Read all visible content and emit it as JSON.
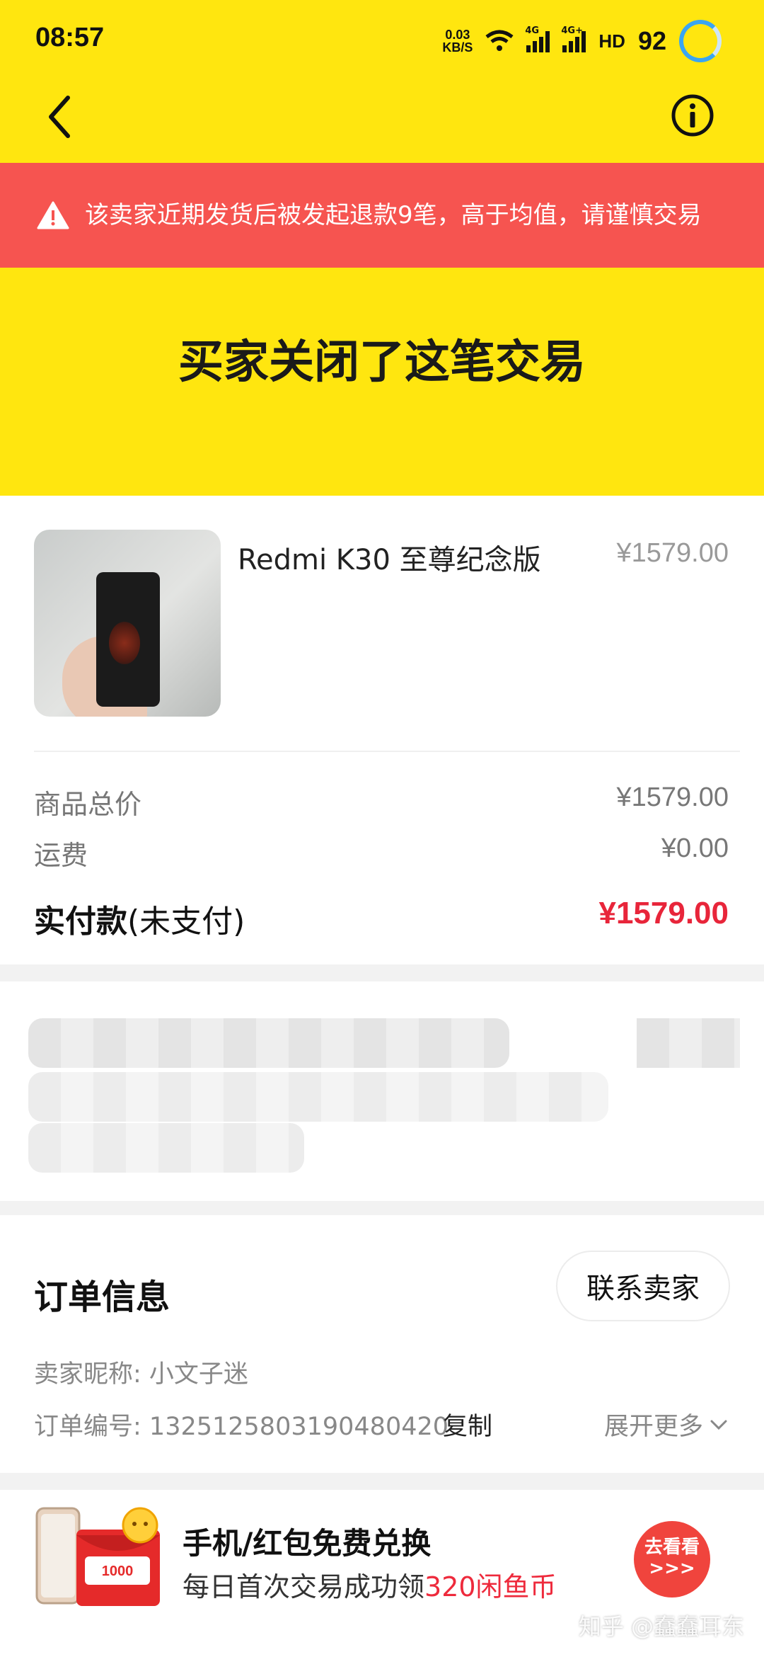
{
  "status_bar": {
    "time": "08:57",
    "net_speed_value": "0.03",
    "net_speed_unit": "KB/S",
    "signal1_label": "4G",
    "signal2_label": "4G+",
    "hd_label": "HD",
    "battery": "92",
    "battery_color": "#3aa5f2"
  },
  "nav": {
    "back_icon": "chevron-left-icon",
    "info_icon": "info-icon"
  },
  "warning": {
    "text": "该卖家近期发货后被发起退款9笔，高于均值，请谨慎交易",
    "bg_color": "#f65450"
  },
  "order_status": {
    "title": "买家关闭了这笔交易",
    "bg_color": "#ffe60f"
  },
  "product": {
    "name": "Redmi K30 至尊纪念版",
    "price": "¥1579.00"
  },
  "pricing": {
    "subtotal_label": "商品总价",
    "subtotal_value": "¥1579.00",
    "shipping_label": "运费",
    "shipping_value": "¥0.00",
    "paid_label": "实付款",
    "paid_suffix": "(未支付)",
    "paid_value": "¥1579.00",
    "paid_color": "#e8253a"
  },
  "order_info": {
    "title": "订单信息",
    "contact_button": "联系卖家",
    "seller_label": "卖家昵称: ",
    "seller_name": "小文子迷",
    "order_no_label": "订单编号: ",
    "order_no": "1325125803190480420",
    "copy_label": "复制",
    "expand_label": "展开更多"
  },
  "promo": {
    "title": "手机/红包免费兑换",
    "subtitle_prefix": "每日首次交易成功领",
    "subtitle_highlight": "320闲鱼币",
    "badge_value": "1000",
    "button_line1": "去看看",
    "button_line2": ">>>"
  },
  "watermark": "知乎 @蠢蠢耳东"
}
